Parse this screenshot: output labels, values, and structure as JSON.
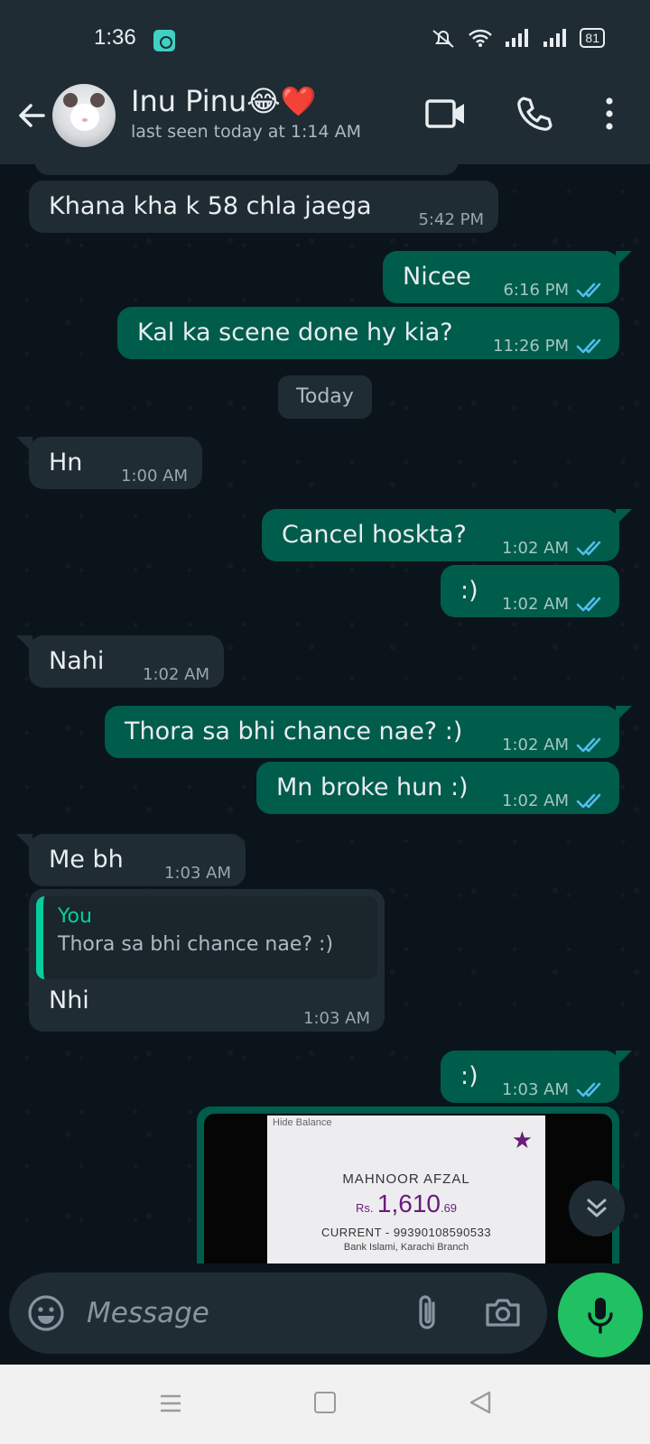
{
  "status_bar": {
    "time": "1:36",
    "battery": "81"
  },
  "header": {
    "contact_name": "Inu Pinu😂❤️",
    "last_seen": "last seen today at 1:14 AM"
  },
  "date_chip": "Today",
  "messages": [
    {
      "direction": "in",
      "text": "Khana kha k 58 chla jaega",
      "time": "5:42 PM"
    },
    {
      "direction": "out",
      "text": "Nicee",
      "time": "6:16 PM",
      "read": true
    },
    {
      "direction": "out",
      "text": "Kal ka scene done hy kia?",
      "time": "11:26 PM",
      "read": true
    },
    {
      "direction": "in",
      "text": "Hn",
      "time": "1:00 AM"
    },
    {
      "direction": "out",
      "text": "Cancel hoskta?",
      "time": "1:02 AM",
      "read": true
    },
    {
      "direction": "out",
      "text": ":)",
      "time": "1:02 AM",
      "read": true
    },
    {
      "direction": "in",
      "text": "Nahi",
      "time": "1:02 AM"
    },
    {
      "direction": "out",
      "text": "Thora sa bhi chance nae? :)",
      "time": "1:02 AM",
      "read": true
    },
    {
      "direction": "out",
      "text": "Mn broke hun :)",
      "time": "1:02 AM",
      "read": true
    },
    {
      "direction": "in",
      "text": "Me bh",
      "time": "1:03 AM"
    },
    {
      "direction": "out",
      "text": ":)",
      "time": "1:03 AM",
      "read": true
    }
  ],
  "reply_message": {
    "quoted_author": "You",
    "quoted_text": "Thora sa bhi chance nae? :)",
    "text": "Nhi",
    "time": "1:03 AM"
  },
  "image_message": {
    "hide_balance": "Hide Balance",
    "account_name": "MAHNOOR AFZAL",
    "currency": "Rs.",
    "balance": "1,610",
    "balance_decimal": ".69",
    "account_line": "CURRENT - 99390108590533",
    "branch_line": "Bank Islami, Karachi Branch"
  },
  "composer": {
    "placeholder": "Message"
  },
  "colors": {
    "outgoing": "#005c4b",
    "incoming": "#1f2c34",
    "accent": "#21c063",
    "read_ticks": "#53bdeb"
  },
  "icons": [
    "back-arrow-icon",
    "video-call-icon",
    "phone-icon",
    "more-vert-icon",
    "emoji-icon",
    "attach-icon",
    "camera-icon",
    "mic-icon",
    "double-chevron-down-icon"
  ]
}
